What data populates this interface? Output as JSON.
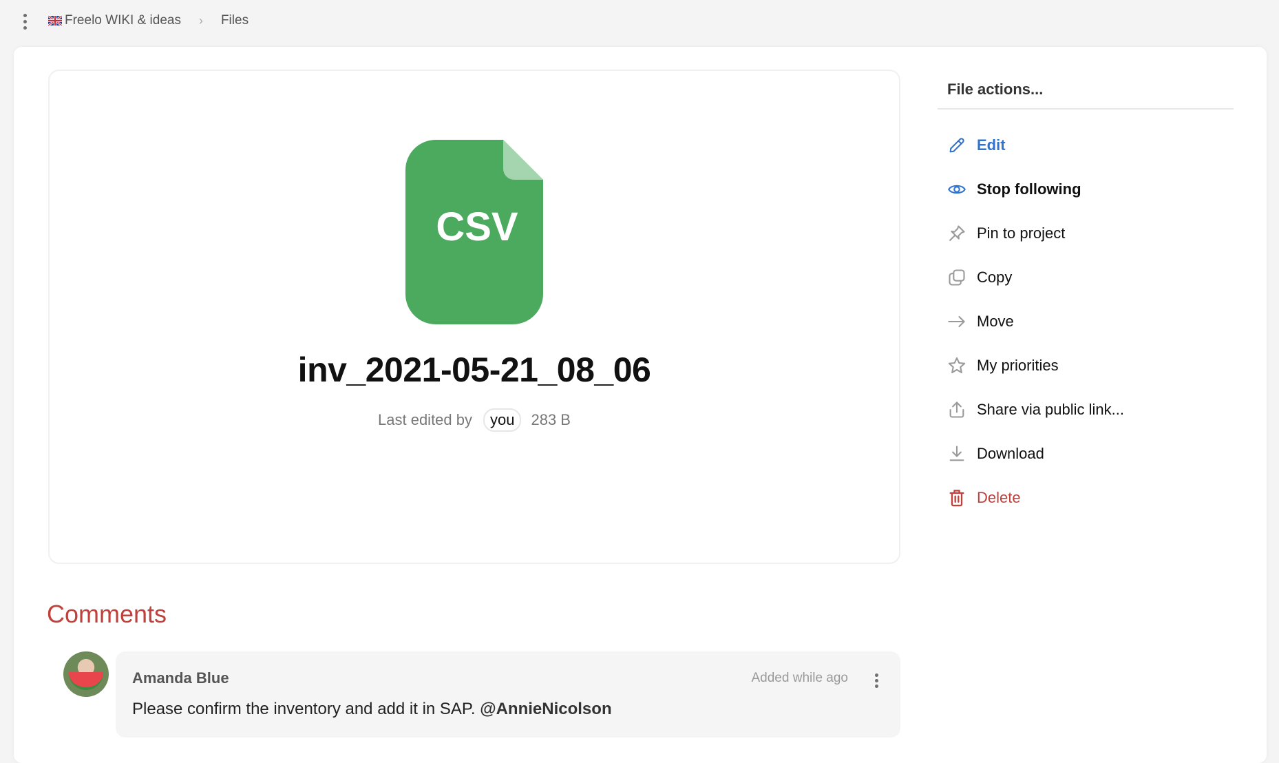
{
  "breadcrumb": {
    "project": "Freelo WIKI & ideas",
    "project_flag": "uk-flag",
    "current": "Files"
  },
  "file": {
    "type_label": "CSV",
    "name": "inv_2021-05-21_08_06",
    "last_edited_label": "Last edited by",
    "last_edited_by": "you",
    "size": "283 B",
    "icon_color": "#4caa5e",
    "icon_fold_color": "#a5d5ae"
  },
  "actions": {
    "title": "File actions...",
    "items": [
      {
        "id": "edit",
        "label": "Edit",
        "icon": "pencil-icon"
      },
      {
        "id": "follow",
        "label": "Stop following",
        "icon": "eye-icon"
      },
      {
        "id": "pin",
        "label": "Pin to project",
        "icon": "pin-icon"
      },
      {
        "id": "copy",
        "label": "Copy",
        "icon": "copy-icon"
      },
      {
        "id": "move",
        "label": "Move",
        "icon": "arrow-right-icon"
      },
      {
        "id": "priorities",
        "label": "My priorities",
        "icon": "star-icon"
      },
      {
        "id": "share",
        "label": "Share via public link...",
        "icon": "share-icon"
      },
      {
        "id": "download",
        "label": "Download",
        "icon": "download-icon"
      },
      {
        "id": "delete",
        "label": "Delete",
        "icon": "trash-icon"
      }
    ]
  },
  "comments": {
    "title": "Comments",
    "items": [
      {
        "author": "Amanda Blue",
        "time": "Added while ago",
        "text": "Please confirm the inventory and add it in SAP. ",
        "mention": "@AnnieNicolson"
      }
    ]
  },
  "colors": {
    "accent": "#2f74d0",
    "danger": "#c0403c",
    "icon_gray": "#9a9a9a"
  }
}
